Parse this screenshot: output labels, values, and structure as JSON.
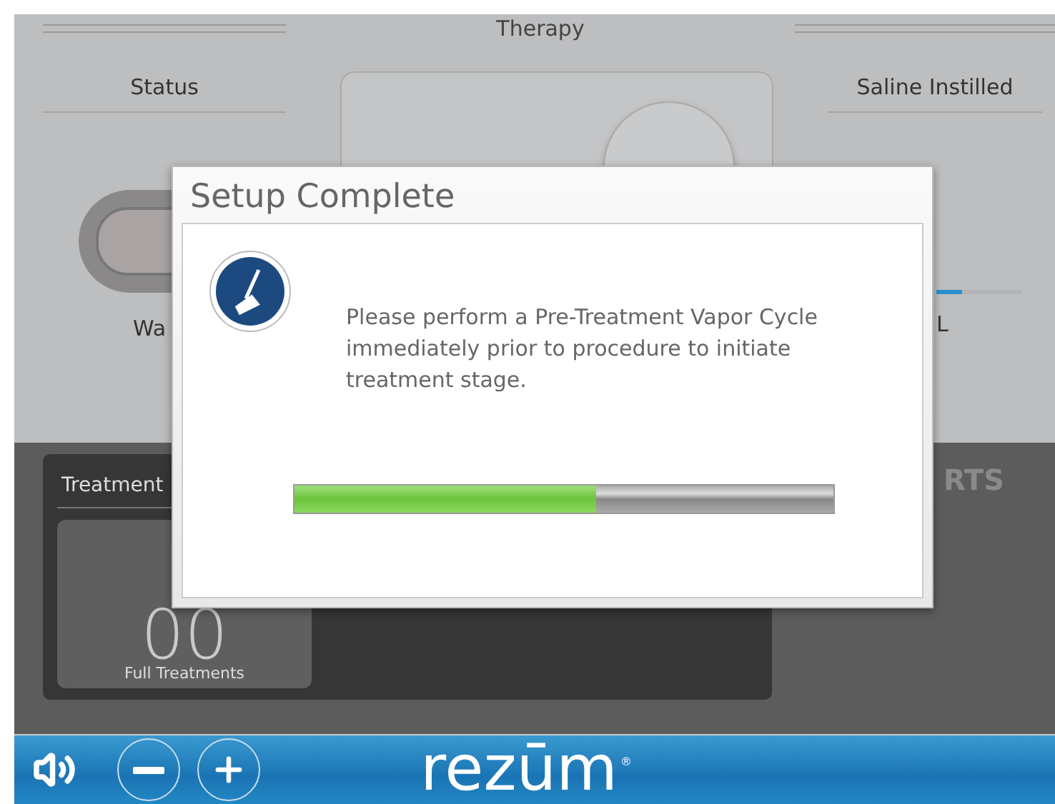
{
  "header": {
    "title": "Therapy"
  },
  "status": {
    "label": "Status",
    "toggle_on": false,
    "caption": "Wa"
  },
  "saline": {
    "label": "Saline Instilled",
    "level": 0.3,
    "caption": "L"
  },
  "treatment_panel": {
    "title": "Treatment",
    "count": "00",
    "count_label": "Full Treatments"
  },
  "alerts_header": "RTS",
  "dialog": {
    "title": "Setup Complete",
    "message": "Please perform a Pre-Treatment Vapor Cycle immediately prior to procedure to initiate treatment stage.",
    "progress": {
      "level": 0.56
    }
  },
  "footer": {
    "logo": "rezūm",
    "logo_mark": "®",
    "buttons": [
      {
        "kind": "volume"
      },
      {
        "kind": "minus"
      },
      {
        "kind": "plus"
      }
    ]
  }
}
